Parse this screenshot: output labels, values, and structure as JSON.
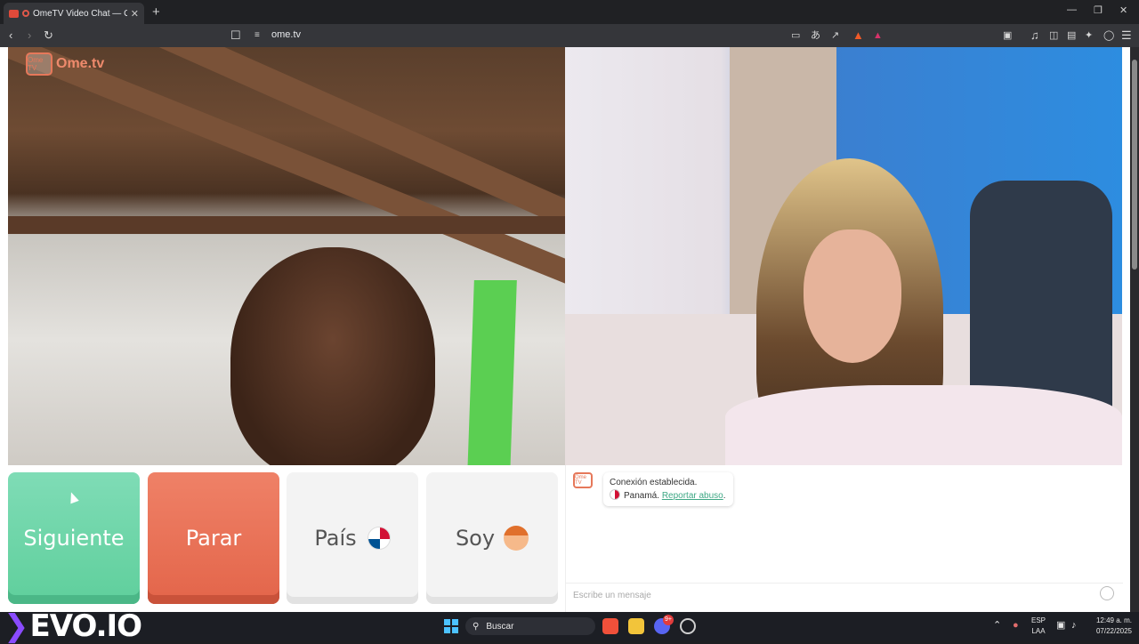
{
  "browser": {
    "tab_title": "OmeTV Video Chat — Omeg",
    "tab_close": "✕",
    "new_tab": "+",
    "url": "ome.tv",
    "window": {
      "minimize": "—",
      "restore": "❐",
      "close": "✕"
    }
  },
  "page": {
    "logo_badge": "Ome TV",
    "logo_text": "Ome.tv",
    "buttons": {
      "next": "Siguiente",
      "stop": "Parar",
      "country": "País",
      "gender": "Soy"
    },
    "chat": {
      "logo_badge": "Ome TV",
      "status": "Conexión establecida.",
      "country": "Panamá.",
      "report_link": "Reportar abuso",
      "report_suffix": ".",
      "input_placeholder": "Escribe un mensaje"
    }
  },
  "taskbar": {
    "brand": "EVO.IO",
    "search_label": "Buscar",
    "lang_top": "ESP",
    "lang_bottom": "LAA",
    "time": "12:49 a. m.",
    "date": "07/22/2025",
    "notification_badge": "9+"
  },
  "colors": {
    "next": "#6fd6a9",
    "stop": "#e8705a",
    "accent_link": "#3ea885",
    "logo": "#e6785a"
  }
}
